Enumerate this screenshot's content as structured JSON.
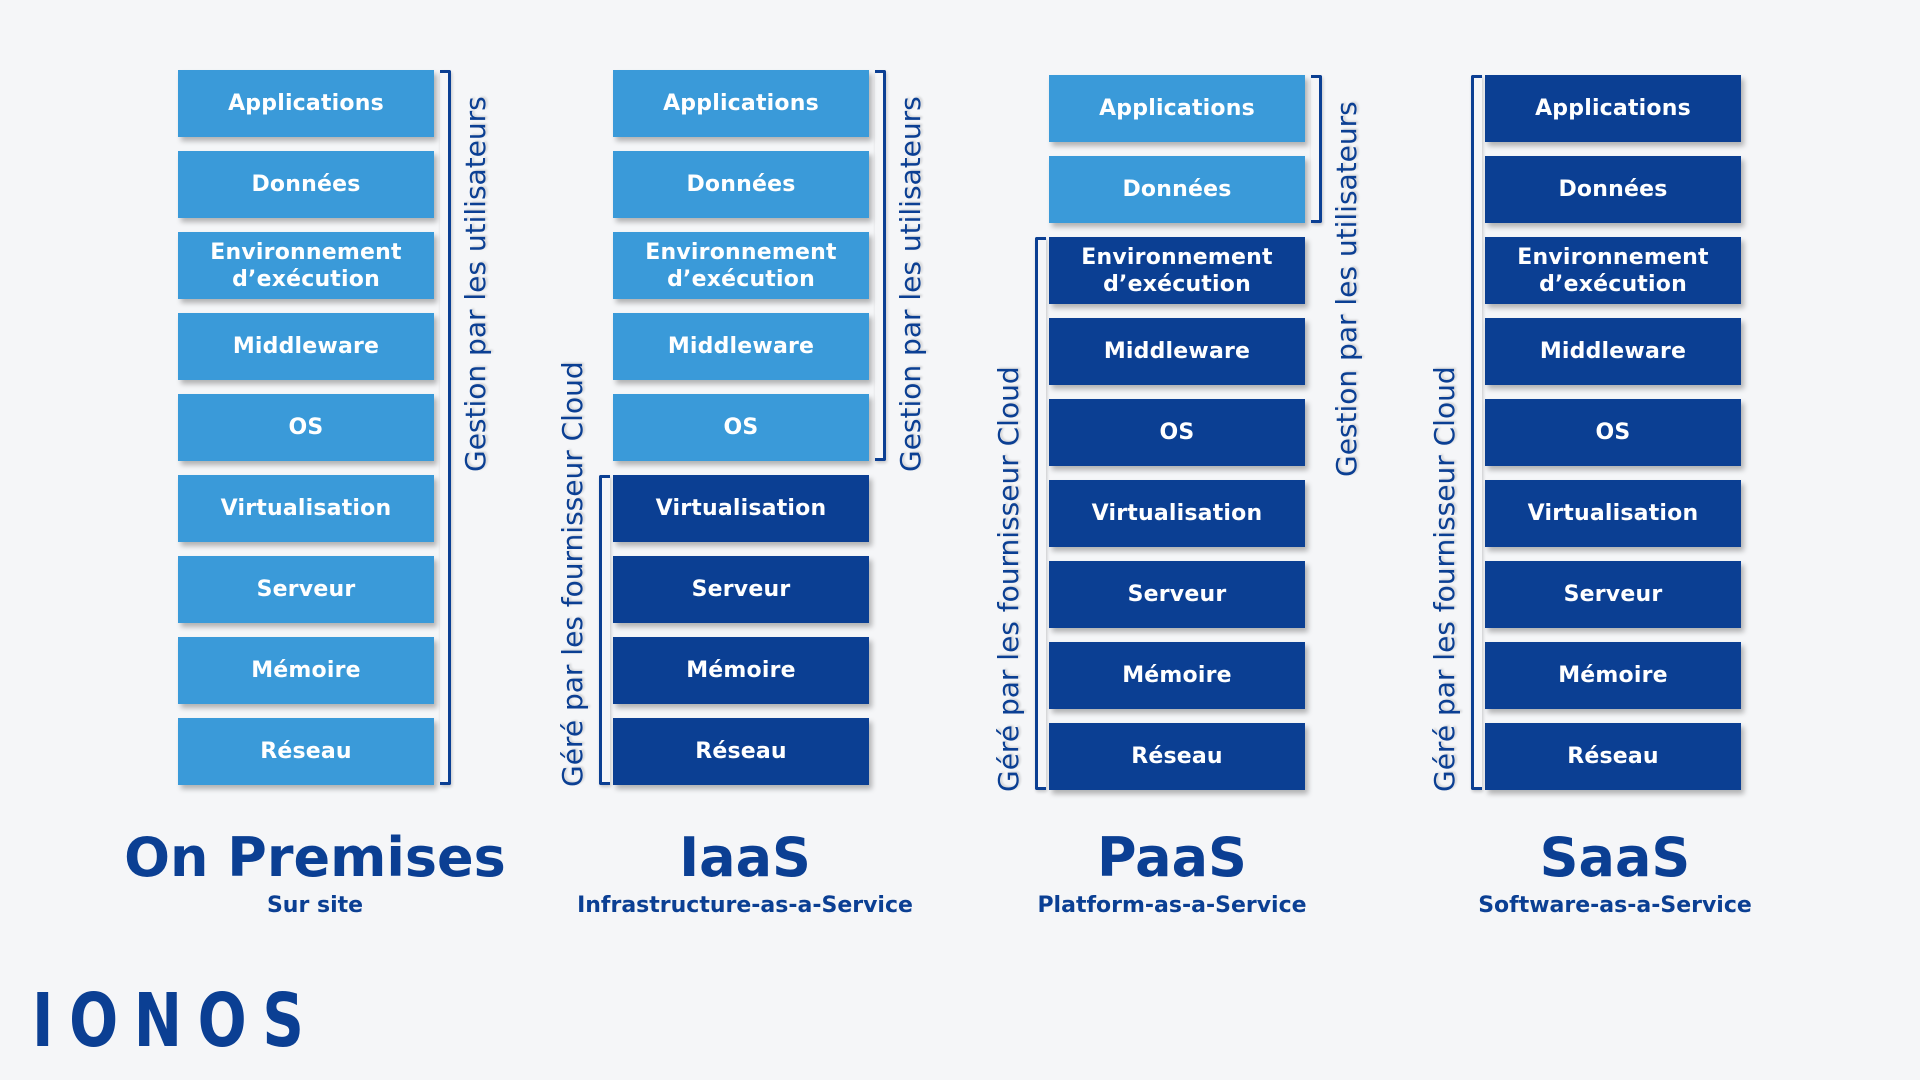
{
  "layers": [
    "Applications",
    "Données",
    "Environnement d’exécution",
    "Middleware",
    "OS",
    "Virtualisation",
    "Serveur",
    "Mémoire",
    "Réseau"
  ],
  "labels": {
    "user_managed": "Gestion par les utilisateurs",
    "provider_managed": "Géré par les fournisseur Cloud"
  },
  "models": [
    {
      "title": "On Premises",
      "subtitle": "Sur site",
      "user_layers_count": 9,
      "layers": [
        "Applications",
        "Données",
        "Environnement\nd’exécution",
        "Middleware",
        "OS",
        "Virtualisation",
        "Serveur",
        "Mémoire",
        "Réseau"
      ]
    },
    {
      "title": "IaaS",
      "subtitle": "Infrastructure-as-a-Service",
      "user_layers_count": 5,
      "layers": [
        "Applications",
        "Données",
        "Environnement\nd’exécution",
        "Middleware",
        "OS",
        "Virtualisation",
        "Serveur",
        "Mémoire",
        "Réseau"
      ]
    },
    {
      "title": "PaaS",
      "subtitle": "Platform-as-a-Service",
      "user_layers_count": 2,
      "layers": [
        "Applications",
        "Données",
        "Environnement\nd’exécution",
        "Middleware",
        "OS",
        "Virtualisation",
        "Serveur",
        "Mémoire",
        "Réseau"
      ]
    },
    {
      "title": "SaaS",
      "subtitle": "Software-as-a-Service",
      "user_layers_count": 0,
      "layers": [
        "Applications",
        "Données",
        "Environnement\nd’exécution",
        "Middleware",
        "OS",
        "Virtualisation",
        "Serveur",
        "Mémoire",
        "Réseau"
      ]
    }
  ],
  "colors": {
    "user_managed": "#3a9ad9",
    "provider_managed": "#0b3f93",
    "text_dark": "#0b3f93",
    "background": "#f5f6f8"
  },
  "logo": {
    "text": "IONOS"
  }
}
